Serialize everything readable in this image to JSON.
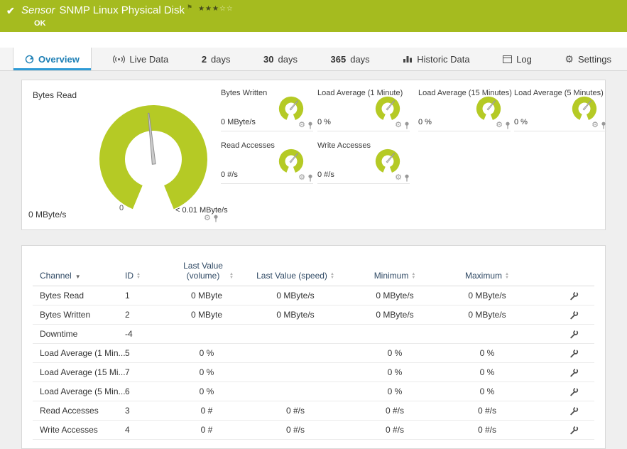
{
  "colors": {
    "header_bg": "#a5bb1f",
    "gauge_arc": "#b5ca25",
    "tab_active_text": "#1d7fb5",
    "tab_underline": "#2e9bd6"
  },
  "header": {
    "type_label": "Sensor",
    "title": "SNMP Linux Physical Disk",
    "status": "OK",
    "stars_filled": "★★★",
    "stars_empty": "☆☆"
  },
  "tabs": [
    {
      "id": "overview",
      "label": "Overview",
      "icon": "overview-icon",
      "active": true
    },
    {
      "id": "live-data",
      "label": "Live Data",
      "icon": "live-data-icon",
      "active": false
    },
    {
      "id": "2-days",
      "num": "2",
      "label": "days",
      "active": false
    },
    {
      "id": "30-days",
      "num": "30",
      "label": "days",
      "active": false
    },
    {
      "id": "365-days",
      "num": "365",
      "label": "days",
      "active": false
    },
    {
      "id": "historic-data",
      "label": "Historic Data",
      "icon": "historic-data-icon",
      "active": false
    },
    {
      "id": "log",
      "label": "Log",
      "icon": "log-icon",
      "active": false
    },
    {
      "id": "settings",
      "label": "Settings",
      "icon": "settings-icon",
      "active": false
    }
  ],
  "gauges": {
    "main": {
      "title": "Bytes Read",
      "value": "0 MByte/s",
      "scale_min": "0",
      "scale_note": "< 0.01 MByte/s"
    },
    "small": [
      {
        "title": "Bytes Written",
        "value": "0 MByte/s"
      },
      {
        "title": "Load Average (1 Minute)",
        "value": "0 %"
      },
      {
        "title": "Load Average (15 Minutes)",
        "value": "0 %"
      },
      {
        "title": "Load Average (5 Minutes)",
        "value": "0 %"
      },
      {
        "title": "Read Accesses",
        "value": "0 #/s"
      },
      {
        "title": "Write Accesses",
        "value": "0 #/s"
      }
    ]
  },
  "table": {
    "columns": {
      "channel": "Channel",
      "id": "ID",
      "volume": "Last Value (volume)",
      "speed": "Last Value (speed)",
      "minimum": "Minimum",
      "maximum": "Maximum"
    },
    "rows": [
      {
        "channel": "Bytes Read",
        "id": "1",
        "volume": "0 MByte",
        "speed": "0 MByte/s",
        "minimum": "0 MByte/s",
        "maximum": "0 MByte/s"
      },
      {
        "channel": "Bytes Written",
        "id": "2",
        "volume": "0 MByte",
        "speed": "0 MByte/s",
        "minimum": "0 MByte/s",
        "maximum": "0 MByte/s"
      },
      {
        "channel": "Downtime",
        "id": "-4",
        "volume": "",
        "speed": "",
        "minimum": "",
        "maximum": ""
      },
      {
        "channel": "Load Average (1 Min...",
        "id": "5",
        "volume": "0 %",
        "speed": "",
        "minimum": "0 %",
        "maximum": "0 %"
      },
      {
        "channel": "Load Average (15 Mi...",
        "id": "7",
        "volume": "0 %",
        "speed": "",
        "minimum": "0 %",
        "maximum": "0 %"
      },
      {
        "channel": "Load Average (5 Min...",
        "id": "6",
        "volume": "0 %",
        "speed": "",
        "minimum": "0 %",
        "maximum": "0 %"
      },
      {
        "channel": "Read Accesses",
        "id": "3",
        "volume": "0 #",
        "speed": "0 #/s",
        "minimum": "0 #/s",
        "maximum": "0 #/s"
      },
      {
        "channel": "Write Accesses",
        "id": "4",
        "volume": "0 #",
        "speed": "0 #/s",
        "minimum": "0 #/s",
        "maximum": "0 #/s"
      }
    ]
  }
}
